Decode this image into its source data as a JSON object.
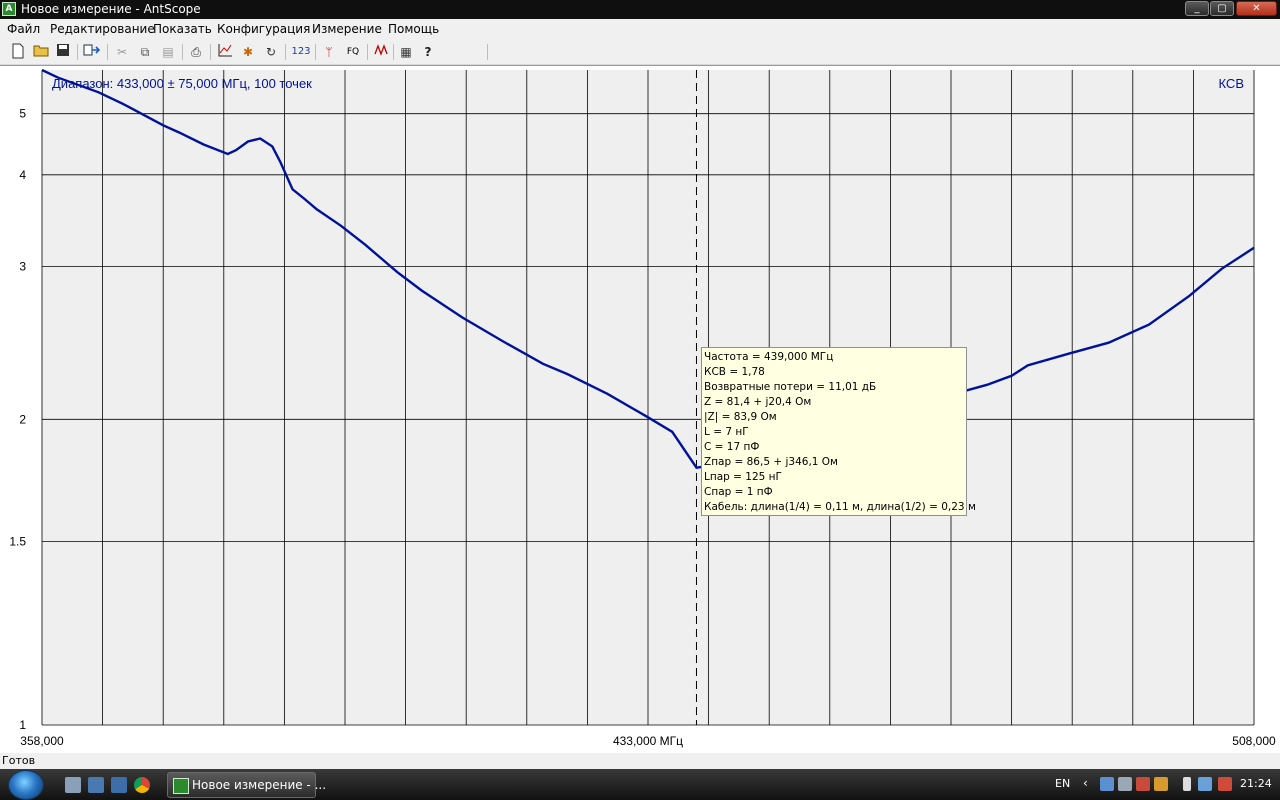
{
  "window": {
    "title": "Новое измерение - AntScope",
    "icon": "antscope-app-icon"
  },
  "menu": [
    "Файл",
    "Редактирование",
    "Показать",
    "Конфигурация",
    "Измерение",
    "Помощь"
  ],
  "toolbar_icons": [
    "new-file-icon",
    "open-folder-icon",
    "save-icon",
    "export-icon",
    "cut-icon",
    "copy-icon",
    "paste-icon",
    "print-icon",
    "chart-icon",
    "marker-icon",
    "refresh-icon",
    "numbers-123-icon",
    "antenna-icon",
    "fq-icon",
    "waveform-icon",
    "table-icon",
    "help-icon"
  ],
  "toolbar": {
    "numbers_label": "123",
    "fq_label": "FQ"
  },
  "plot": {
    "range_label": "Диапазон: 433,000 ± 75,000 МГц, 100 точек",
    "mode_label": "КСВ",
    "colors": {
      "background": "#efefef",
      "grid": "#000000",
      "curve": "#00129a",
      "label": "#00129a"
    }
  },
  "chart_data": {
    "type": "line",
    "xlabel": "",
    "ylabel": "",
    "x_ticks": [
      "358,000",
      "433,000 МГц",
      "508,000"
    ],
    "y_ticks": [
      "5",
      "4",
      "3",
      "2",
      "1.5",
      "1"
    ],
    "xlim": [
      358,
      508
    ],
    "ylim": [
      1,
      6
    ],
    "y_scale": "log-reflection",
    "grid": true,
    "marker_x": 439.0,
    "series": [
      {
        "x": [
          358,
          360,
          365,
          368,
          373,
          375,
          378,
          381,
          382,
          383.5,
          385,
          386.5,
          387.5,
          389,
          390.5,
          392,
          395,
          398,
          402,
          405,
          410,
          415,
          420,
          423,
          428,
          433,
          436,
          439,
          441,
          443,
          447,
          452,
          458,
          463,
          468,
          470,
          475,
          478,
          480,
          485,
          490,
          495,
          500,
          504,
          508
        ],
        "y": [
          6.0,
          5.8,
          5.45,
          5.2,
          4.78,
          4.65,
          4.45,
          4.3,
          4.36,
          4.5,
          4.55,
          4.42,
          4.18,
          3.81,
          3.69,
          3.57,
          3.39,
          3.2,
          2.95,
          2.8,
          2.6,
          2.44,
          2.3,
          2.24,
          2.13,
          2.01,
          1.94,
          1.78,
          1.79,
          1.8,
          1.85,
          1.9,
          1.95,
          2.0,
          2.05,
          2.12,
          2.18,
          2.23,
          2.29,
          2.36,
          2.43,
          2.55,
          2.76,
          2.98,
          3.17
        ]
      }
    ]
  },
  "tooltip": [
    "Частота = 439,000 МГц",
    "КСВ = 1,78",
    "Возвратные потери = 11,01 дБ",
    "Z = 81,4 + j20,4 Ом",
    "|Z| = 83,9 Ом",
    "L = 7 нГ",
    "C = 17 пФ",
    "Zпар = 86,5 + j346,1 Ом",
    "Lпар = 125 нГ",
    "Cпар = 1 пФ",
    "Кабель: длина(1/4) = 0,11 м, длина(1/2) = 0,23 м"
  ],
  "status": "Готов",
  "taskbar": {
    "task_label": "Новое измерение - ...",
    "language": "EN",
    "clock": "21:24"
  }
}
